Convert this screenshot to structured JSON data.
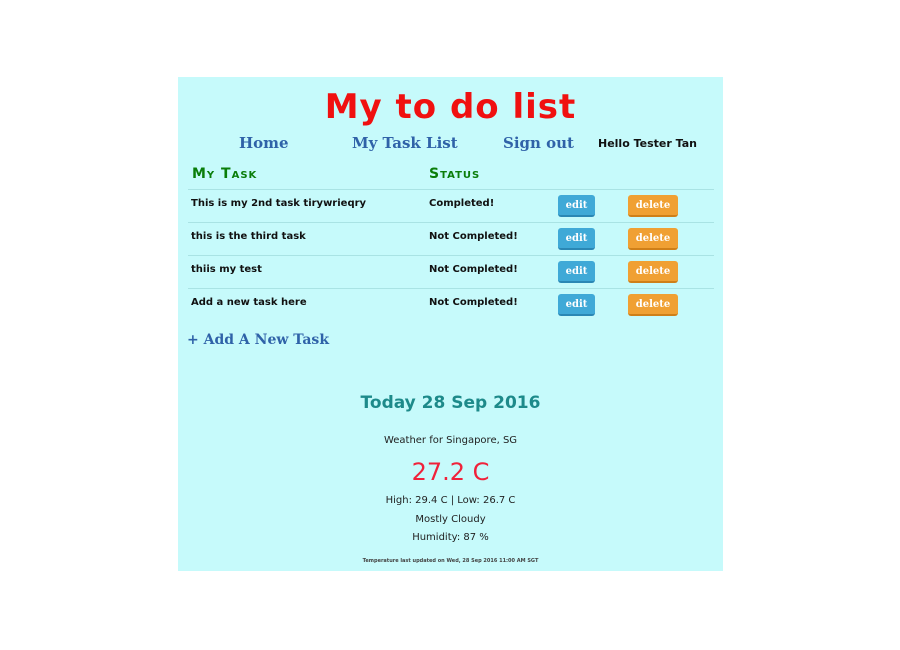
{
  "app": {
    "title": "My to do list"
  },
  "nav": {
    "home": "Home",
    "task_list": "My Task List",
    "sign_out": "Sign out",
    "greeting": "Hello Tester Tan"
  },
  "table": {
    "headers": {
      "task": "My Task",
      "status": "Status"
    },
    "rows": [
      {
        "task": "This is my 2nd task tirywrieqry",
        "status": "Completed!",
        "edit": "edit",
        "delete": "delete"
      },
      {
        "task": "this is the third task",
        "status": "Not Completed!",
        "edit": "edit",
        "delete": "delete"
      },
      {
        "task": "thiis my test",
        "status": "Not Completed!",
        "edit": "edit",
        "delete": "delete"
      },
      {
        "task": "Add a new task here",
        "status": "Not Completed!",
        "edit": "edit",
        "delete": "delete"
      }
    ]
  },
  "add_task": {
    "label": "+ Add A New Task"
  },
  "weather": {
    "today": "Today 28 Sep 2016",
    "location": "Weather for Singapore, SG",
    "temperature": "27.2 C",
    "high_low": "High: 29.4 C | Low: 26.7 C",
    "condition": "Mostly Cloudy",
    "humidity": "Humidity: 87 %",
    "last_updated": "Temperature last updated on Wed, 28 Sep 2016 11:00 AM SGT"
  },
  "colors": {
    "background": "#c6fafb",
    "title": "#f01010",
    "nav_link": "#2f62a8",
    "header": "#0a7d0a",
    "edit_button": "#3fa9d7",
    "delete_button": "#f0a033",
    "temperature": "#f0223a"
  }
}
